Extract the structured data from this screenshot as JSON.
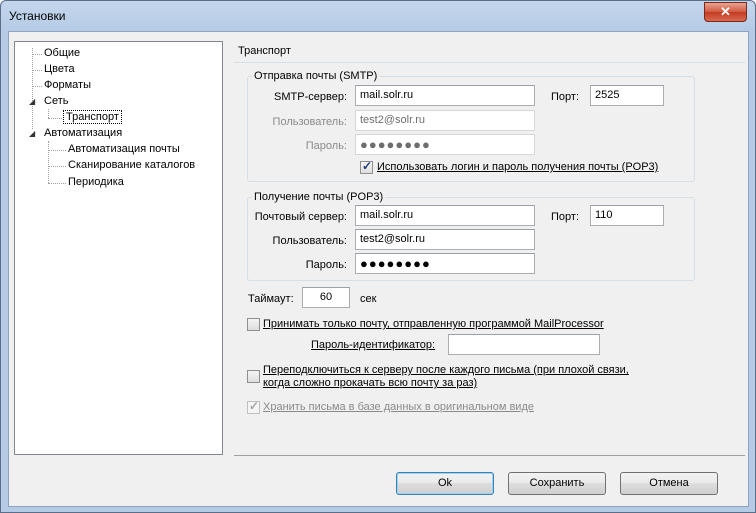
{
  "window": {
    "title": "Установки",
    "close_glyph": "✕"
  },
  "tree": {
    "items": [
      {
        "label": "Общие"
      },
      {
        "label": "Цвета"
      },
      {
        "label": "Форматы"
      },
      {
        "label": "Сеть",
        "expander": "◢"
      },
      {
        "label": "Транспорт",
        "selected": true
      },
      {
        "label": "Автоматизация",
        "expander": "◢"
      },
      {
        "label": "Автоматизация почты"
      },
      {
        "label": "Сканирование каталогов"
      },
      {
        "label": "Периодика"
      }
    ]
  },
  "panel": {
    "title": "Транспорт",
    "smtp": {
      "group_label": "Отправка почты (SMTP)",
      "server_label": "SMTP-сервер:",
      "server_value": "mail.solr.ru",
      "port_label": "Порт:",
      "port_value": "2525",
      "user_label": "Пользователь:",
      "user_value": "test2@solr.ru",
      "password_label": "Пароль:",
      "password_value": "●●●●●●●●",
      "use_pop3_label": "Использовать логин и пароль получения почты (POP3)",
      "use_pop3_checked": true
    },
    "pop3": {
      "group_label": "Получение почты (POP3)",
      "server_label": "Почтовый сервер:",
      "server_value": "mail.solr.ru",
      "port_label": "Порт:",
      "port_value": "110",
      "user_label": "Пользователь:",
      "user_value": "test2@solr.ru",
      "password_label": "Пароль:",
      "password_value": "●●●●●●●●"
    },
    "timeout": {
      "label": "Таймаут:",
      "value": "60",
      "unit": "сек"
    },
    "only_mailprocessor": {
      "label": "Принимать только почту, отправленную программой MailProcessor",
      "checked": false,
      "password_id_label": "Пароль-идентификатор:",
      "password_id_value": ""
    },
    "reconnect": {
      "label_line1": "Переподключиться к серверу после каждого письма (при плохой связи,",
      "label_line2": "когда сложно прокачать всю почту за раз)",
      "checked": false
    },
    "store_original": {
      "label": "Хранить письма в базе данных в оригинальном виде",
      "checked": true,
      "disabled": true
    }
  },
  "buttons": {
    "ok": "Ok",
    "save": "Сохранить",
    "cancel": "Отмена"
  },
  "checkmark_glyph": "✓"
}
